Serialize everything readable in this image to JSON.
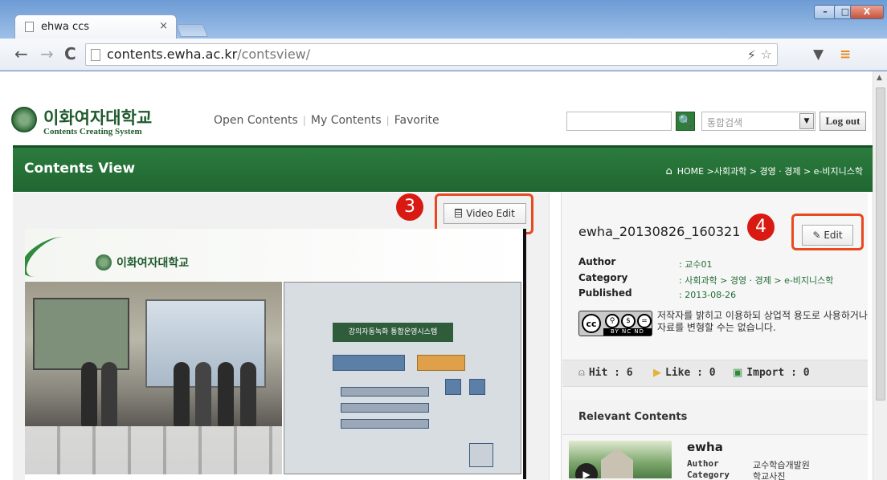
{
  "browser": {
    "tab_title": "ehwa ccs",
    "tab_close": "×",
    "url_host": "contents.ewha.ac.kr",
    "url_path": "/contsview/",
    "window_controls": [
      "–",
      "□",
      "X"
    ]
  },
  "site": {
    "logo_title": "이화여자대학교",
    "logo_subtitle": "Contents Creating System",
    "nav": [
      "Open Contents",
      "My Contents",
      "Favorite"
    ],
    "search_placeholder": "",
    "search_scope": "통합검색",
    "logout_label": "Log out"
  },
  "header": {
    "title": "Contents View",
    "breadcrumb": "HOME >사회과학 > 경영 · 경제 > e-비지니스학"
  },
  "video": {
    "edit_label": "Video Edit",
    "overlay_logo": "이화여자대학교",
    "slide_heading": "강의자동녹화 통합운영시스템"
  },
  "content": {
    "title": "ewha_20130826_160321",
    "edit_label": "Edit",
    "meta": [
      {
        "label": "Author",
        "value": ": 교수01"
      },
      {
        "label": "Category",
        "value": ": 사회과학 > 경영 · 경제 > e-비지니스학"
      },
      {
        "label": "Published",
        "value": ": 2013-08-26"
      }
    ],
    "license_badge": "cc",
    "license_strip": "BY NC ND",
    "license_text": "저작자를 밝히고 이용하되 상업적 용도로 사용하거나 자료를 변형할 수는 없습니다.",
    "stats": {
      "hit": "Hit : 6",
      "like": "Like : 0",
      "import": "Import : 0"
    }
  },
  "relevant": {
    "header": "Relevant Contents",
    "items": [
      {
        "title": "ewha",
        "author_label": "Author",
        "author": "교수학습개발원",
        "category_label": "Category",
        "category": "학교사진"
      }
    ]
  },
  "annotations": {
    "video_edit_marker": "3",
    "edit_marker": "4",
    "highlight_color": "#e8491f",
    "marker_color": "#d91a12"
  },
  "colors": {
    "brand_green": "#2c7b3e",
    "link_green": "#1f6e33"
  }
}
